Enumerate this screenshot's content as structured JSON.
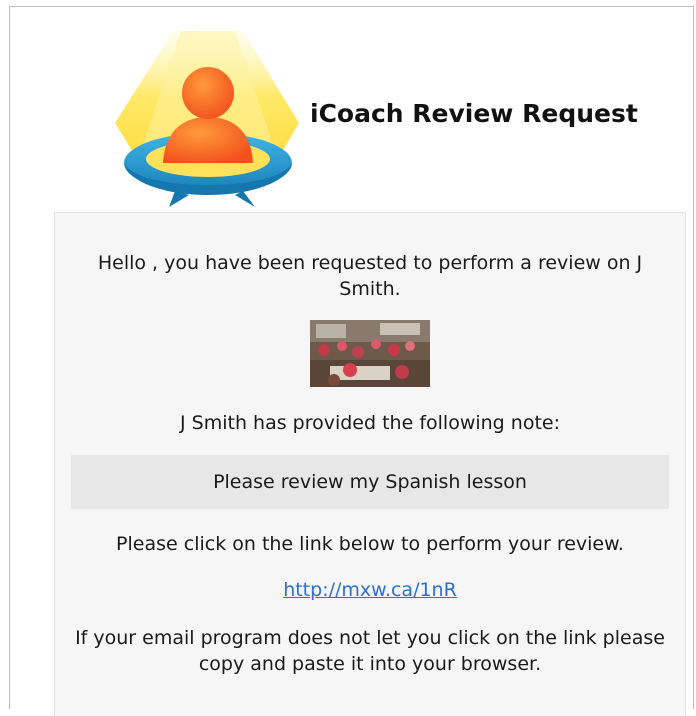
{
  "header": {
    "title": "iCoach Review Request",
    "logo_icon": "icoach-spotlight-person-icon"
  },
  "email": {
    "greeting": "Hello , you have been requested to perform a review on J Smith.",
    "thumbnail_icon": "classroom-video-thumbnail",
    "note_intro": "J Smith has provided the following note:",
    "note": "Please review my Spanish lesson",
    "instruction": "Please click on the link below to perform your review.",
    "review_link": "http://mxw.ca/1nR",
    "fallback": "If your email program does not let you click on the link please copy and paste it into your browser."
  },
  "colors": {
    "link": "#2a6fdb",
    "card_background": "#f6f6f6",
    "note_background": "#e7e7e7"
  }
}
